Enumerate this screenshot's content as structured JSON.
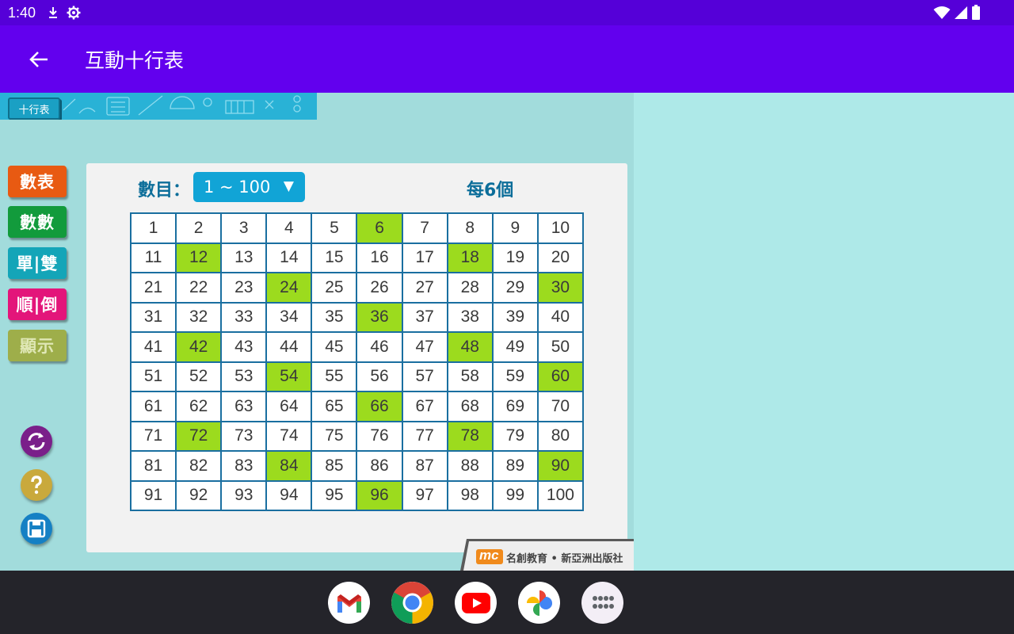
{
  "status_bar": {
    "time": "1:40",
    "icons": [
      "download-icon",
      "settings-gear-icon",
      "wifi-icon",
      "signal-icon",
      "battery-icon"
    ]
  },
  "app_bar": {
    "title": "互動十行表",
    "back_icon": "arrow-back-icon"
  },
  "banner": {
    "tag_label": "十行表"
  },
  "sidebar": {
    "buttons": [
      {
        "label": "數表",
        "color": "#e85a12"
      },
      {
        "label": "數數",
        "color": "#129b3c"
      },
      {
        "label": "單|雙",
        "color": "#14a5b8"
      },
      {
        "label": "順|倒",
        "color": "#e3157a"
      },
      {
        "label": "顯示",
        "color": "#9eae4a"
      }
    ],
    "round_buttons": [
      {
        "icon": "refresh-icon",
        "color": "#7a1f8a"
      },
      {
        "icon": "help-icon",
        "color": "#c9a93c"
      },
      {
        "icon": "save-icon",
        "color": "#1580c4"
      }
    ]
  },
  "panel": {
    "count_label": "數目：",
    "range_value": "1 ~ 100",
    "every_label": "每6個",
    "highlight_color": "#9cdb1e",
    "numbers": [
      "1",
      "2",
      "3",
      "4",
      "5",
      "6",
      "7",
      "8",
      "9",
      "10",
      "11",
      "12",
      "13",
      "14",
      "15",
      "16",
      "17",
      "18",
      "19",
      "20",
      "21",
      "22",
      "23",
      "24",
      "25",
      "26",
      "27",
      "28",
      "29",
      "30",
      "31",
      "32",
      "33",
      "34",
      "35",
      "36",
      "37",
      "38",
      "39",
      "40",
      "41",
      "42",
      "43",
      "44",
      "45",
      "46",
      "47",
      "48",
      "49",
      "50",
      "51",
      "52",
      "53",
      "54",
      "55",
      "56",
      "57",
      "58",
      "59",
      "60",
      "61",
      "62",
      "63",
      "64",
      "65",
      "66",
      "67",
      "68",
      "69",
      "70",
      "71",
      "72",
      "73",
      "74",
      "75",
      "76",
      "77",
      "78",
      "79",
      "80",
      "81",
      "82",
      "83",
      "84",
      "85",
      "86",
      "87",
      "88",
      "89",
      "90",
      "91",
      "92",
      "93",
      "94",
      "95",
      "96",
      "97",
      "98",
      "99",
      "100"
    ],
    "highlighted": [
      6,
      12,
      18,
      24,
      30,
      36,
      42,
      48,
      54,
      60,
      66,
      72,
      78,
      84,
      90,
      96
    ]
  },
  "publisher": {
    "logo_text": "mc",
    "name": "名創教育 • 新亞洲出版社"
  },
  "dock": {
    "apps": [
      {
        "name": "Gmail",
        "icon": "gmail-icon"
      },
      {
        "name": "Chrome",
        "icon": "chrome-icon"
      },
      {
        "name": "YouTube",
        "icon": "youtube-icon"
      },
      {
        "name": "Photos",
        "icon": "photos-icon"
      },
      {
        "name": "All apps",
        "icon": "app-drawer-icon"
      }
    ]
  }
}
